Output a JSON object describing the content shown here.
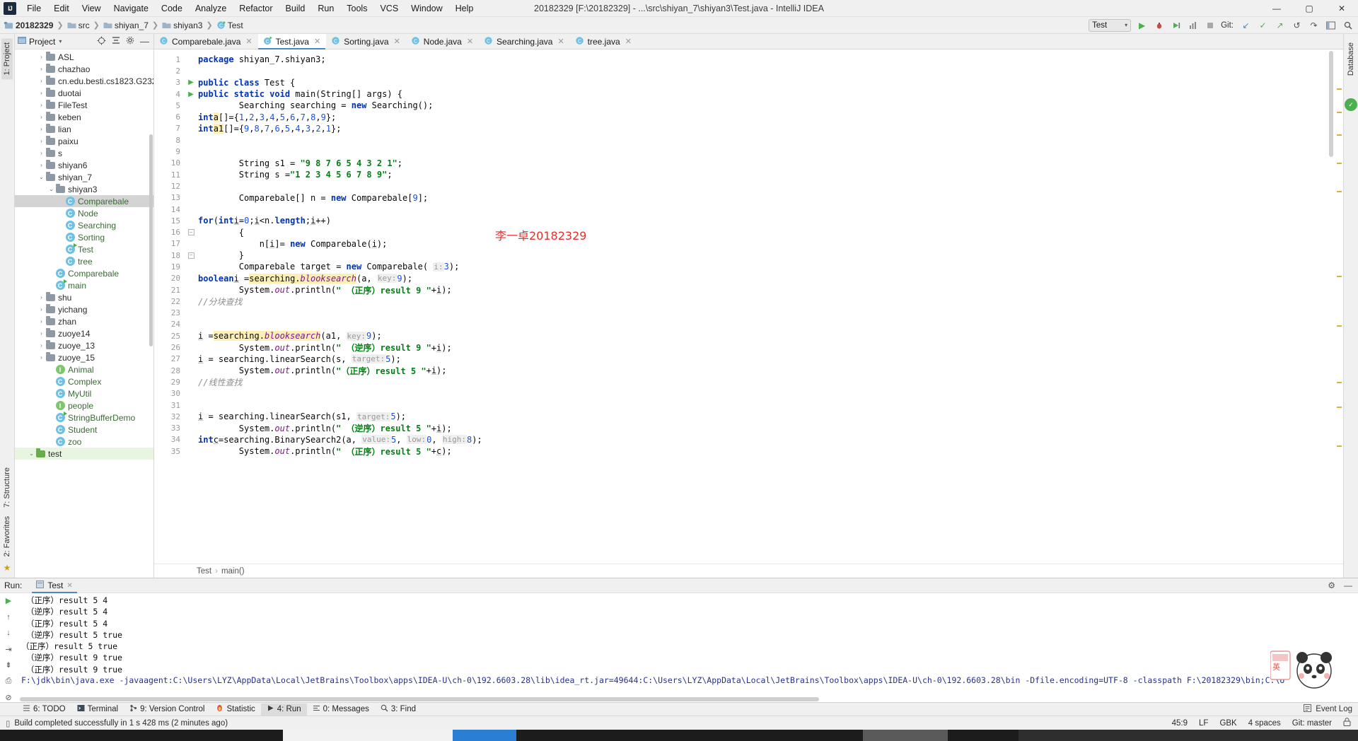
{
  "window": {
    "title": "20182329 [F:\\20182329] - ...\\src\\shiyan_7\\shiyan3\\Test.java - IntelliJ IDEA",
    "logo": "IJ",
    "minimize": "—",
    "maximize": "▢",
    "close": "✕"
  },
  "menu": [
    "File",
    "Edit",
    "View",
    "Navigate",
    "Code",
    "Analyze",
    "Refactor",
    "Build",
    "Run",
    "Tools",
    "VCS",
    "Window",
    "Help"
  ],
  "breadcrumb": {
    "items": [
      {
        "label": "20182329",
        "icon": "module-icon"
      },
      {
        "label": "src",
        "icon": "folder-icon"
      },
      {
        "label": "shiyan_7",
        "icon": "folder-icon"
      },
      {
        "label": "shiyan3",
        "icon": "folder-icon"
      },
      {
        "label": "Test",
        "icon": "class-icon"
      }
    ],
    "separator": "❯"
  },
  "toolbar": {
    "run_config": "Test",
    "run_config_caret": "▾",
    "run_icon": "▶",
    "debug_icon": "🐞",
    "coverage_icon": "▶|",
    "profile_icon": "▦",
    "stop_icon": "■",
    "git_label": "Git:",
    "git_update_icon": "↙",
    "git_commit_icon": "✓",
    "git_push_icon": "↗",
    "git_history_icon": "↺",
    "git_revert_icon": "↷",
    "layout_icon": "▤",
    "search_icon": "🔍"
  },
  "left_strip": {
    "tabs": [
      "1: Project"
    ],
    "bottom": [
      "7: Structure",
      "2: Favorites"
    ]
  },
  "right_strip": {
    "tabs": [
      "Database"
    ]
  },
  "project": {
    "title": "Project",
    "caret": "▾",
    "icons": [
      "target-icon",
      "collapse-icon",
      "settings-icon",
      "hide-icon"
    ],
    "tree": [
      {
        "label": "ASL",
        "depth": 2,
        "type": "folder",
        "arrow": "›"
      },
      {
        "label": "chazhao",
        "depth": 2,
        "type": "folder",
        "arrow": "›"
      },
      {
        "label": "cn.edu.besti.cs1823.G2329",
        "depth": 2,
        "type": "folder",
        "arrow": "›"
      },
      {
        "label": "duotai",
        "depth": 2,
        "type": "folder",
        "arrow": "›"
      },
      {
        "label": "FileTest",
        "depth": 2,
        "type": "folder",
        "arrow": "›"
      },
      {
        "label": "keben",
        "depth": 2,
        "type": "folder",
        "arrow": "›"
      },
      {
        "label": "lian",
        "depth": 2,
        "type": "folder",
        "arrow": "›"
      },
      {
        "label": "paixu",
        "depth": 2,
        "type": "folder",
        "arrow": "›"
      },
      {
        "label": "s",
        "depth": 2,
        "type": "folder",
        "arrow": "›"
      },
      {
        "label": "shiyan6",
        "depth": 2,
        "type": "folder",
        "arrow": "›"
      },
      {
        "label": "shiyan_7",
        "depth": 2,
        "type": "folder",
        "arrow": "⌄"
      },
      {
        "label": "shiyan3",
        "depth": 3,
        "type": "folder",
        "arrow": "⌄"
      },
      {
        "label": "Comparebale",
        "depth": 4,
        "type": "class",
        "arrow": "",
        "selected": true
      },
      {
        "label": "Node",
        "depth": 4,
        "type": "class",
        "arrow": ""
      },
      {
        "label": "Searching",
        "depth": 4,
        "type": "class",
        "arrow": ""
      },
      {
        "label": "Sorting",
        "depth": 4,
        "type": "class",
        "arrow": ""
      },
      {
        "label": "Test",
        "depth": 4,
        "type": "class-runnable",
        "arrow": ""
      },
      {
        "label": "tree",
        "depth": 4,
        "type": "class",
        "arrow": ""
      },
      {
        "label": "Comparebale",
        "depth": 3,
        "type": "class",
        "arrow": ""
      },
      {
        "label": "main",
        "depth": 3,
        "type": "class-runnable",
        "arrow": ""
      },
      {
        "label": "shu",
        "depth": 2,
        "type": "folder",
        "arrow": "›"
      },
      {
        "label": "yichang",
        "depth": 2,
        "type": "folder",
        "arrow": "›"
      },
      {
        "label": "zhan",
        "depth": 2,
        "type": "folder",
        "arrow": "›"
      },
      {
        "label": "zuoye14",
        "depth": 2,
        "type": "folder",
        "arrow": "›"
      },
      {
        "label": "zuoye_13",
        "depth": 2,
        "type": "folder",
        "arrow": "›"
      },
      {
        "label": "zuoye_15",
        "depth": 2,
        "type": "folder",
        "arrow": "›"
      },
      {
        "label": "Animal",
        "depth": 3,
        "type": "interface",
        "arrow": ""
      },
      {
        "label": "Complex",
        "depth": 3,
        "type": "class",
        "arrow": ""
      },
      {
        "label": "MyUtil",
        "depth": 3,
        "type": "class",
        "arrow": ""
      },
      {
        "label": "people",
        "depth": 3,
        "type": "interface",
        "arrow": ""
      },
      {
        "label": "StringBufferDemo",
        "depth": 3,
        "type": "class-runnable",
        "arrow": ""
      },
      {
        "label": "Student",
        "depth": 3,
        "type": "class",
        "arrow": ""
      },
      {
        "label": "zoo",
        "depth": 3,
        "type": "class",
        "arrow": ""
      },
      {
        "label": "test",
        "depth": 1,
        "type": "folder-green",
        "arrow": "⌄",
        "highlighted": true
      }
    ]
  },
  "editor": {
    "tabs": [
      {
        "label": "Comparebale.java",
        "icon": "class-icon",
        "active": false,
        "close": "✕"
      },
      {
        "label": "Test.java",
        "icon": "class-runnable-icon",
        "active": true,
        "close": "✕"
      },
      {
        "label": "Sorting.java",
        "icon": "class-icon",
        "active": false,
        "close": "✕"
      },
      {
        "label": "Node.java",
        "icon": "class-icon",
        "active": false,
        "close": "✕"
      },
      {
        "label": "Searching.java",
        "icon": "class-icon",
        "active": false,
        "close": "✕"
      },
      {
        "label": "tree.java",
        "icon": "class-icon",
        "active": false,
        "close": "✕"
      }
    ],
    "watermark": "李一卓20182329",
    "watermark_color": "#e2302b",
    "first_line": 1,
    "last_line": 35,
    "breadcrumb": [
      "Test",
      "main()"
    ],
    "breadcrumb_sep": "›",
    "lines": [
      {
        "n": 1,
        "html": "<span class=\"kw\">package</span> shiyan_7.shiyan3;"
      },
      {
        "n": 2,
        "html": ""
      },
      {
        "n": 3,
        "html": "<span class=\"kw\">public class</span> Test {",
        "run": true
      },
      {
        "n": 4,
        "html": "    <span class=\"kw\">public static void</span> main(String[] args) {",
        "run": true,
        "fold": true
      },
      {
        "n": 5,
        "html": "        Searching searching = <span class=\"kw\">new</span> Searching();"
      },
      {
        "n": 6,
        "html": "        <span class=\"kw\">int</span> <span class=\"hl\">a</span>[]={<span class=\"num\">1</span>,<span class=\"num\">2</span>,<span class=\"num\">3</span>,<span class=\"num\">4</span>,<span class=\"num\">5</span>,<span class=\"num\">6</span>,<span class=\"num\">7</span>,<span class=\"num\">8</span>,<span class=\"num\">9</span>};"
      },
      {
        "n": 7,
        "html": "        <span class=\"kw\">int</span> <span class=\"hl\">a1</span>[]={<span class=\"num\">9</span>,<span class=\"num\">8</span>,<span class=\"num\">7</span>,<span class=\"num\">6</span>,<span class=\"num\">5</span>,<span class=\"num\">4</span>,<span class=\"num\">3</span>,<span class=\"num\">2</span>,<span class=\"num\">1</span>};"
      },
      {
        "n": 8,
        "html": ""
      },
      {
        "n": 9,
        "html": ""
      },
      {
        "n": 10,
        "html": "        String s1 = <span class=\"str\">\"9 8 7 6 5 4 3 2 1\"</span>;"
      },
      {
        "n": 11,
        "html": "        String s =<span class=\"str\">\"1 2 3 4 5 6 7 8 9\"</span>;"
      },
      {
        "n": 12,
        "html": ""
      },
      {
        "n": 13,
        "html": "        Comparebale[] n = <span class=\"kw\">new</span> Comparebale[<span class=\"num\">9</span>];"
      },
      {
        "n": 14,
        "html": ""
      },
      {
        "n": 15,
        "html": "        <span class=\"kw\">for</span>(<span class=\"kw\">int</span> <span class=\"ul\">i</span>=<span class=\"num\">0</span>;<span class=\"ul\">i</span>&lt;n.<span class=\"kw\">length</span>;<span class=\"ul\">i</span>++)"
      },
      {
        "n": 16,
        "html": "        {",
        "fold": true
      },
      {
        "n": 17,
        "html": "            n[<span class=\"ul\">i</span>]= <span class=\"kw\">new</span> Comparebale(<span class=\"ul\">i</span>);"
      },
      {
        "n": 18,
        "html": "        }",
        "fold": true
      },
      {
        "n": 19,
        "html": "        Comparebale target = <span class=\"kw\">new</span> Comparebale( <span class=\"hint\">i:</span> <span class=\"num\">3</span>);"
      },
      {
        "n": 20,
        "html": "        <span class=\"kw\">boolean</span> <span class=\"ul\">i</span> =<span class=\"hl\">searching.<span class=\"stat\">blooksearch</span></span>(a, <span class=\"hint\">key:</span> <span class=\"num\">9</span>);"
      },
      {
        "n": 21,
        "html": "        System.<span class=\"fld\">out</span>.println(<span class=\"str\">\" （正序）result 9 \"</span>+<span class=\"ul\">i</span>);"
      },
      {
        "n": 22,
        "html": "        <span class=\"cmt\">//分块查找</span>"
      },
      {
        "n": 23,
        "html": ""
      },
      {
        "n": 24,
        "html": ""
      },
      {
        "n": 25,
        "html": "        <span class=\"ul\">i</span> =<span class=\"hl\">searching.<span class=\"stat\">blooksearch</span></span>(a1, <span class=\"hint\">key:</span> <span class=\"num\">9</span>);"
      },
      {
        "n": 26,
        "html": "        System.<span class=\"fld\">out</span>.println(<span class=\"str\">\" （逆序）result 9 \"</span>+<span class=\"ul\">i</span>);"
      },
      {
        "n": 27,
        "html": "        <span class=\"ul\">i</span> = searching.linearSearch(s, <span class=\"hint\">target:</span> <span class=\"num\">5</span>);"
      },
      {
        "n": 28,
        "html": "        System.<span class=\"fld\">out</span>.println(<span class=\"str\">\"（正序）result 5 \"</span>+<span class=\"ul\">i</span>);"
      },
      {
        "n": 29,
        "html": "        <span class=\"cmt\">//线性查找</span>"
      },
      {
        "n": 30,
        "html": ""
      },
      {
        "n": 31,
        "html": ""
      },
      {
        "n": 32,
        "html": "        <span class=\"ul\">i</span> = searching.linearSearch(s1, <span class=\"hint\">target:</span> <span class=\"num\">5</span>);"
      },
      {
        "n": 33,
        "html": "        System.<span class=\"fld\">out</span>.println(<span class=\"str\">\" （逆序）result 5 \"</span>+<span class=\"ul\">i</span>);"
      },
      {
        "n": 34,
        "html": "        <span class=\"kw\">int</span> <span class=\"ul\">c</span>=searching.BinarySearch2(a, <span class=\"hint\">value:</span> <span class=\"num\">5</span>, <span class=\"hint\">low:</span> <span class=\"num\">0</span>, <span class=\"hint\">high:</span> <span class=\"num\">8</span>);"
      },
      {
        "n": 35,
        "html": "        System.<span class=\"fld\">out</span>.println(<span class=\"str\">\" （正序）result 5 \"</span>+<span class=\"ul\">c</span>);"
      }
    ]
  },
  "run_panel": {
    "label": "Run:",
    "tab": "Test",
    "tab_close": "✕",
    "settings_icon": "⚙",
    "hide_icon": "—",
    "toolbar_icons": [
      "rerun-icon",
      "scroll-up-icon",
      "scroll-down-icon",
      "soft-wrap-icon",
      "scroll-end-icon",
      "print-icon",
      "clear-icon"
    ],
    "console": [
      "F:\\jdk\\bin\\java.exe -javaagent:C:\\Users\\LYZ\\AppData\\Local\\JetBrains\\Toolbox\\apps\\IDEA-U\\ch-0\\192.6603.28\\lib\\idea_rt.jar=49644:C:\\Users\\LYZ\\AppData\\Local\\JetBrains\\Toolbox\\apps\\IDEA-U\\ch-0\\192.6603.28\\bin -Dfile.encoding=UTF-8 -classpath F:\\20182329\\bin;C:\\U",
      " （正序）result 9 true",
      " （逆序）result 9 true",
      "（正序）result 5 true",
      " （逆序）result 5 true",
      " （正序）result 5 4",
      " （逆序）result 5 4",
      " （正序）result 5 4"
    ],
    "watermark_text": "英"
  },
  "toolwindow_bar": {
    "items": [
      {
        "label": "6: TODO",
        "icon": "todo-icon",
        "active": false
      },
      {
        "label": "Terminal",
        "icon": "terminal-icon",
        "active": false
      },
      {
        "label": "9: Version Control",
        "icon": "vcs-icon",
        "active": false
      },
      {
        "label": "Statistic",
        "icon": "statistic-icon",
        "active": false
      },
      {
        "label": "4: Run",
        "icon": "run-icon",
        "active": true
      },
      {
        "label": "0: Messages",
        "icon": "messages-icon",
        "active": false
      },
      {
        "label": "3: Find",
        "icon": "find-icon",
        "active": false
      }
    ],
    "event_log": "Event Log",
    "event_log_icon": "▤"
  },
  "statusbar": {
    "message": "Build completed successfully in 1 s 428 ms (2 minutes ago)",
    "message_icon": "▯",
    "caret": "45:9",
    "line_sep": "LF",
    "encoding": "GBK",
    "indent": "4 spaces",
    "branch": "Git: master",
    "lock_icon": "🔒"
  }
}
